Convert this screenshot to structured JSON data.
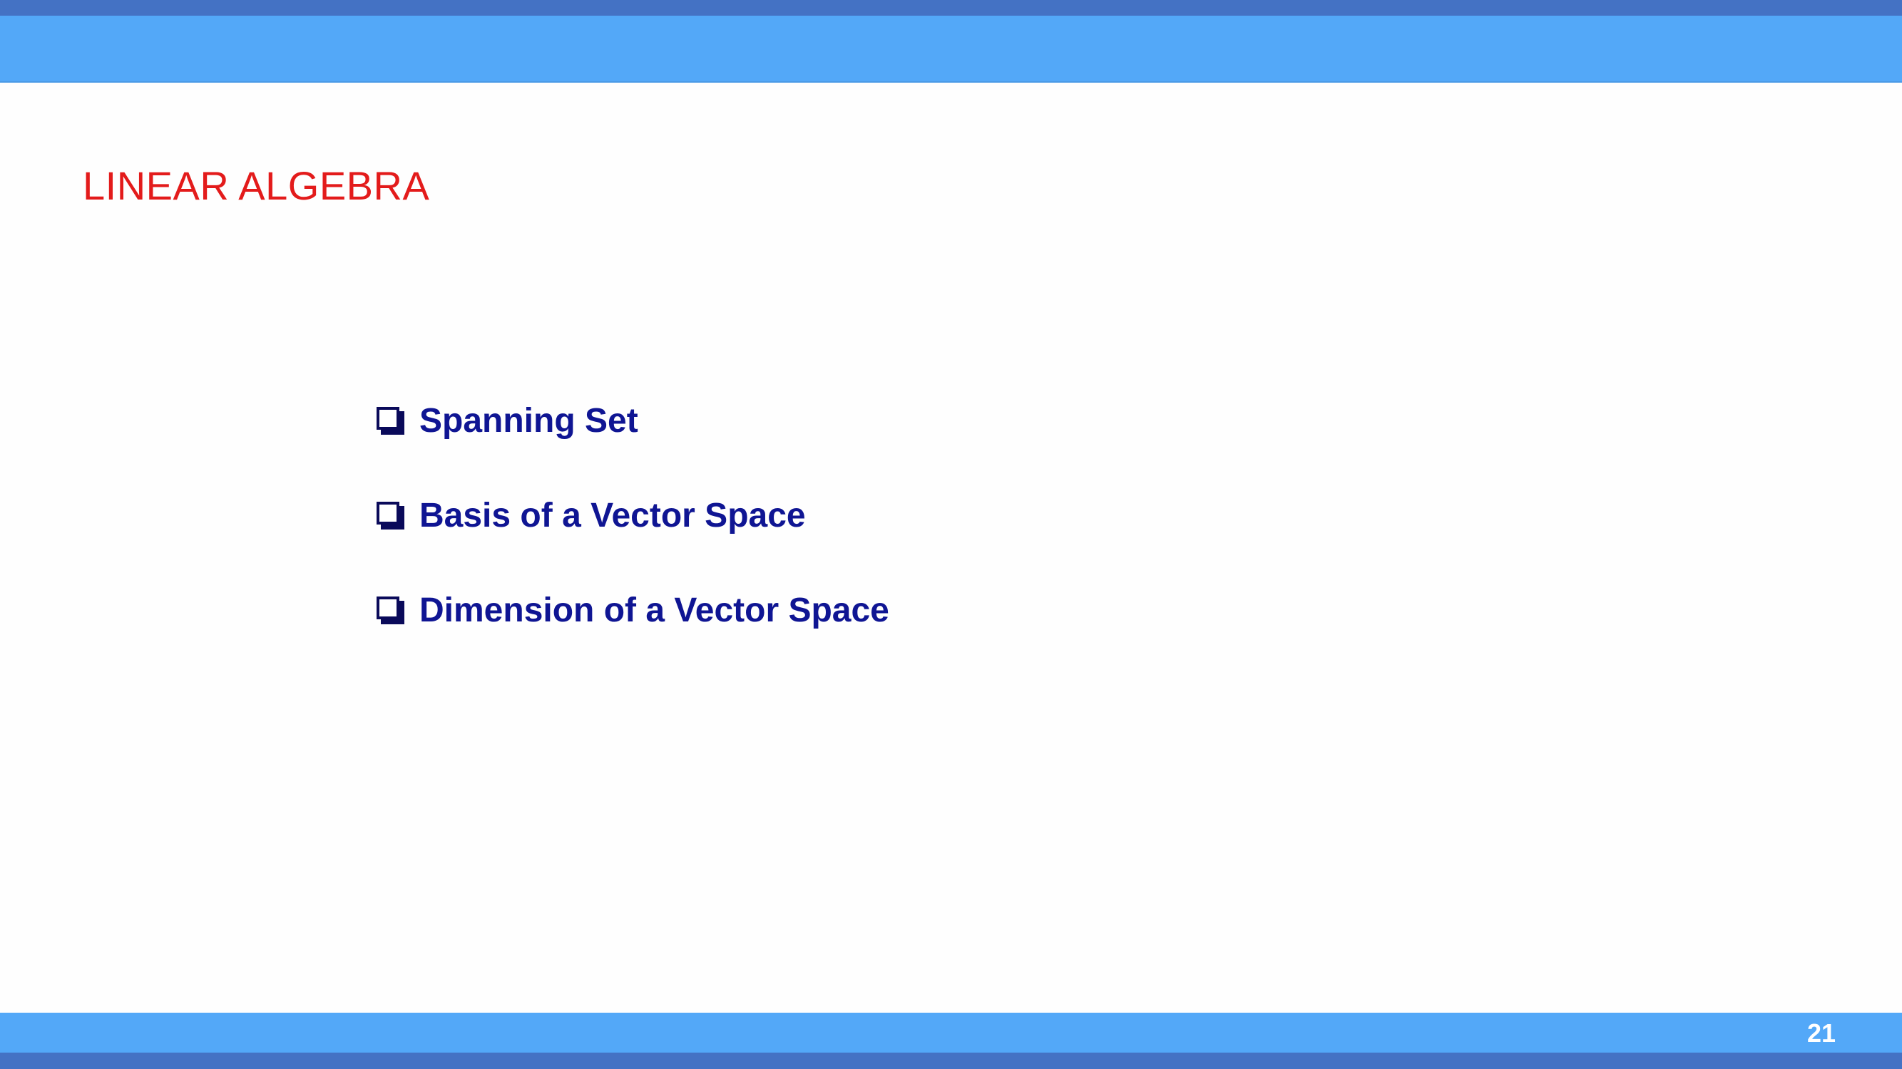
{
  "slide": {
    "title": "LINEAR ALGEBRA",
    "bullets": [
      {
        "label": "Spanning Set",
        "icon": "checkbox-icon"
      },
      {
        "label": "Basis of a Vector Space",
        "icon": "checkbox-icon"
      },
      {
        "label": "Dimension of a Vector Space",
        "icon": "checkbox-icon"
      }
    ],
    "page_number": "21"
  },
  "colors": {
    "band_dark": "#4472c4",
    "band_light": "#53a8f8",
    "title": "#e31b1b",
    "bullet_text": "#0f1593"
  }
}
